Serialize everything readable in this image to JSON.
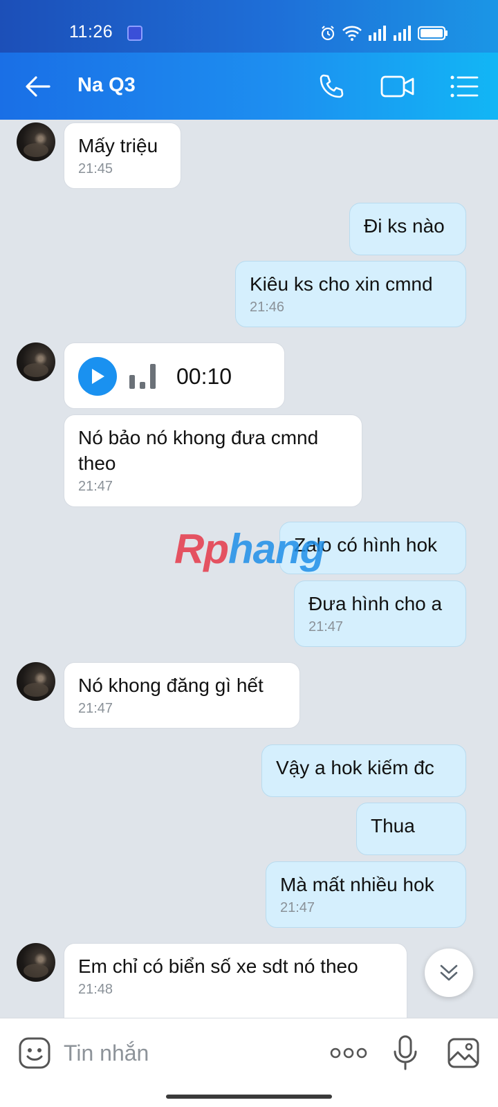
{
  "status_bar": {
    "time": "11:26",
    "icons": [
      "alarm-icon",
      "wifi-icon",
      "signal-icon",
      "signal-icon",
      "battery-icon"
    ]
  },
  "header": {
    "contact_name": "Na Q3",
    "icons": [
      "back-arrow-icon",
      "phone-icon",
      "video-call-icon",
      "menu-list-icon"
    ]
  },
  "colors": {
    "header_gradient_start": "#1a6fe6",
    "header_gradient_end": "#12b6f5",
    "outgoing_bubble": "#d5effd",
    "incoming_bubble": "#ffffff",
    "chat_background": "#dfe4ea",
    "accent": "#1a91f0"
  },
  "messages": [
    {
      "direction": "in",
      "text": "Mấy triệu",
      "time": "21:45"
    },
    {
      "direction": "out",
      "text": "Đi ks nào",
      "time": ""
    },
    {
      "direction": "out",
      "text": "Kiêu ks cho xin cmnd",
      "time": "21:46"
    },
    {
      "direction": "in",
      "type": "voice",
      "duration": "00:10"
    },
    {
      "direction": "in",
      "text": "Nó bảo nó khong đưa cmnd theo",
      "time": "21:47"
    },
    {
      "direction": "out",
      "text": "Zalo có hình hok",
      "time": ""
    },
    {
      "direction": "out",
      "text": "Đưa hình cho a",
      "time": "21:47"
    },
    {
      "direction": "in",
      "text": "Nó khong đăng gì hết",
      "time": "21:47"
    },
    {
      "direction": "out",
      "text": "Vậy a hok kiếm đc",
      "time": ""
    },
    {
      "direction": "out",
      "text": "Thua",
      "time": ""
    },
    {
      "direction": "out",
      "text": "Mà mất nhiều hok",
      "time": "21:47"
    },
    {
      "direction": "in",
      "text": "Em chỉ có biển số xe sdt nó theo",
      "time": "21:48"
    }
  ],
  "watermark": {
    "part_a": "Rp",
    "part_b": "hang"
  },
  "input_bar": {
    "placeholder": "Tin nhắn",
    "icons": [
      "emoji-icon",
      "more-dots-icon",
      "microphone-icon",
      "image-icon"
    ]
  }
}
